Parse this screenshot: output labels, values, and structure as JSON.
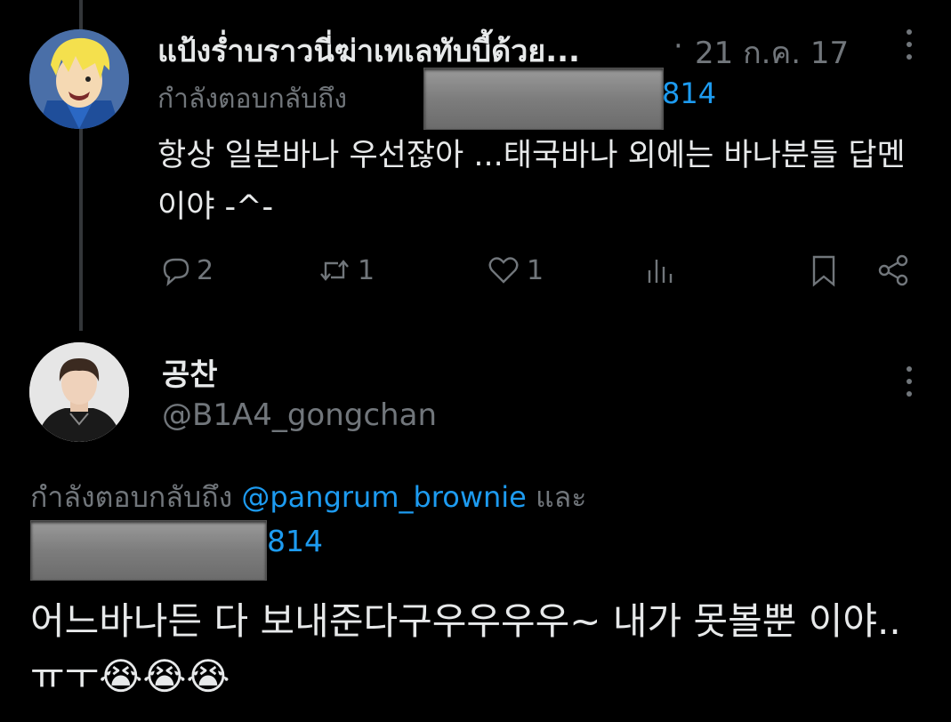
{
  "tweet1": {
    "display_name": "แป้งร่ำบราวนี่ฆ่าเทเลทับบี้ด้วย...",
    "separator": "·",
    "date": "21 ก.ค. 17",
    "reply_prefix": "กำลังตอบกลับถึง",
    "reply_handle_visible": "814",
    "text": "항상 일본바나 우선잖아 ...태국바나 외에는 바나분들 답멘이야 -^-",
    "actions": {
      "replies": "2",
      "retweets": "1",
      "likes": "1"
    }
  },
  "tweet2": {
    "display_name": "공찬",
    "handle": "@B1A4_gongchan",
    "reply_prefix": "กำลังตอบกลับถึง",
    "reply_mention": "@pangrum_brownie",
    "reply_and": "และ",
    "reply_handle_visible": "814",
    "text": "어느바나든 다 보내준다구우우우우~ 내가 못볼뿐 이야..ㅠㅜ😭😭😭"
  },
  "colors": {
    "background": "#000000",
    "text": "#e7e9ea",
    "muted": "#71767b",
    "link": "#1d9bf0",
    "thread_line": "#333639"
  }
}
